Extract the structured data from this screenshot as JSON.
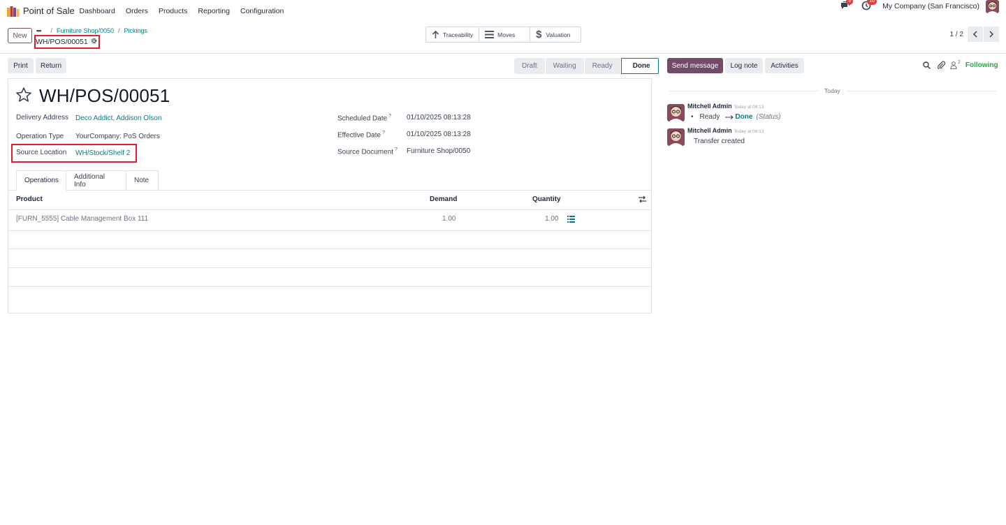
{
  "topbar": {
    "app_name": "Point of Sale",
    "menu": [
      "Dashboard",
      "Orders",
      "Products",
      "Reporting",
      "Configuration"
    ],
    "chat_badge": "9",
    "activity_badge": "10",
    "company": "My Company (San Francisco)"
  },
  "control": {
    "new_label": "New",
    "breadcrumb": [
      "Furniture Shop/0050",
      "Pickings"
    ],
    "record": "WH/POS/00051",
    "smart_buttons": [
      "Traceability",
      "Moves",
      "Valuation"
    ],
    "pager": "1 / 2"
  },
  "form": {
    "print_label": "Print",
    "return_label": "Return",
    "stages": [
      "Draft",
      "Waiting",
      "Ready",
      "Done"
    ],
    "active_stage": "Done",
    "title": "WH/POS/00051",
    "delivery_address_label": "Delivery Address",
    "delivery_address": "Deco Addict, Addison Olson",
    "operation_type_label": "Operation Type",
    "operation_type": "YourCompany: PoS Orders",
    "source_location_label": "Source Location",
    "source_location": "WH/Stock/Shelf 2",
    "scheduled_date_label": "Scheduled Date",
    "scheduled_date": "01/10/2025 08:13:28",
    "effective_date_label": "Effective Date",
    "effective_date": "01/10/2025 08:13:28",
    "source_document_label": "Source Document",
    "source_document": "Furniture Shop/0050",
    "help_mark": "?",
    "tabs": [
      "Operations",
      "Additional Info",
      "Note"
    ],
    "table": {
      "headers": [
        "Product",
        "Demand",
        "Quantity"
      ],
      "rows": [
        {
          "product": "[FURN_5555] Cable Management Box 111",
          "demand": "1.00",
          "quantity": "1.00"
        }
      ]
    }
  },
  "chatter": {
    "send_message": "Send message",
    "log_note": "Log note",
    "activities": "Activities",
    "followers_count": "2",
    "following": "Following",
    "date_separator": "Today",
    "messages": [
      {
        "author": "Mitchell Admin",
        "time": "Today at 08:13",
        "from": "Ready",
        "to": "Done",
        "field": "(Status)"
      },
      {
        "author": "Mitchell Admin",
        "time": "Today at 08:13",
        "body": "Transfer created"
      }
    ]
  },
  "colors": {
    "brand": "#714b67",
    "link": "#017e84",
    "highlight": "#e11d2e",
    "following": "#28a745"
  }
}
